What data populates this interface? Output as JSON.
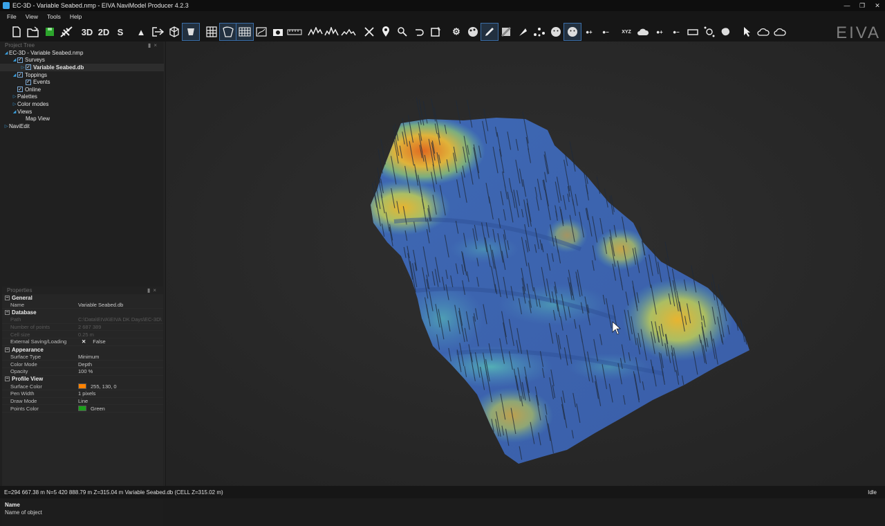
{
  "window": {
    "title": "EC-3D - Variable Seabed.nmp - EIVA NaviModel Producer 4.2.3",
    "controls": [
      "—",
      "❐",
      "✕"
    ]
  },
  "menu": [
    "File",
    "View",
    "Tools",
    "Help"
  ],
  "toolbar": {
    "mode_3d": "3D",
    "mode_2d": "2D",
    "mode_s": "S",
    "icons": [
      "new-project-icon",
      "open-icon",
      "save-icon",
      "satellite-icon",
      "3d-view-icon",
      "2d-view-icon",
      "s-view-icon",
      "north-arrow-icon",
      "import-icon",
      "cube-icon",
      "shade-icon",
      "grid-icon",
      "select-area-icon",
      "mesh-icon",
      "contour-icon",
      "camera-icon",
      "measure-icon",
      "profile-icon",
      "profile2-icon",
      "profile3-icon",
      "tools-icon",
      "pin-icon",
      "route-icon",
      "undo-icon",
      "crop-icon",
      "gear-icon",
      "palette-icon",
      "edit-icon",
      "texture-icon",
      "flag-icon",
      "points-icon",
      "face-icon",
      "face2-icon",
      "point-add-icon",
      "point-remove-icon",
      "xyz-icon",
      "cloud-icon",
      "point-a-icon",
      "point-b-icon",
      "car-icon",
      "nodes-icon",
      "blob-icon",
      "cursor-icon",
      "upload-icon",
      "cloud-out-icon"
    ],
    "logo": "EIVA"
  },
  "project_tree": {
    "header": "Project Tree",
    "items": [
      {
        "label": "EC-3D - Variable Seabed.nmp",
        "level": 0,
        "expander": "open",
        "checkbox": false,
        "bold": false
      },
      {
        "label": "Surveys",
        "level": 1,
        "expander": "open",
        "checkbox": true,
        "bold": false
      },
      {
        "label": "Variable Seabed.db",
        "level": 2,
        "expander": "closed",
        "checkbox": true,
        "bold": true,
        "selected": true
      },
      {
        "label": "Toppings",
        "level": 1,
        "expander": "open",
        "checkbox": true,
        "bold": false
      },
      {
        "label": "Events",
        "level": 2,
        "expander": "none",
        "checkbox": true,
        "bold": false
      },
      {
        "label": "Online",
        "level": 1,
        "expander": "none",
        "checkbox": true,
        "bold": false
      },
      {
        "label": "Palettes",
        "level": 1,
        "expander": "closed",
        "checkbox": false,
        "bold": false
      },
      {
        "label": "Color modes",
        "level": 1,
        "expander": "closed",
        "checkbox": false,
        "bold": false
      },
      {
        "label": "Views",
        "level": 1,
        "expander": "open",
        "checkbox": false,
        "bold": false
      },
      {
        "label": "Map View",
        "level": 2,
        "expander": "none",
        "checkbox": false,
        "bold": false
      },
      {
        "label": "NaviEdit",
        "level": 0,
        "expander": "closed",
        "checkbox": false,
        "bold": false
      }
    ]
  },
  "properties": {
    "header": "Properties",
    "sections": [
      {
        "name": "General",
        "rows": [
          {
            "key": "Name",
            "value": "Variable Seabed.db"
          }
        ]
      },
      {
        "name": "Database",
        "rows": [
          {
            "key": "Path",
            "value": "C:\\Data\\EIVA\\EIVA DK Days\\EC-3D\\",
            "dim": true
          },
          {
            "key": "Number of points",
            "value": "2 687 389",
            "dim": true
          },
          {
            "key": "Cell size",
            "value": "0.25 m",
            "dim": true
          },
          {
            "key": "External Saving/Loading",
            "value": "False",
            "xmark": true
          }
        ]
      },
      {
        "name": "Appearance",
        "rows": [
          {
            "key": "Surface Type",
            "value": "Minimum"
          },
          {
            "key": "Color Mode",
            "value": "Depth"
          },
          {
            "key": "Opacity",
            "value": "100 %"
          }
        ]
      },
      {
        "name": "Profile View",
        "rows": [
          {
            "key": "Surface Color",
            "value": "255, 130, 0",
            "swatch": "#ff8200"
          },
          {
            "key": "Pen Width",
            "value": "1 pixels"
          },
          {
            "key": "Draw Mode",
            "value": "Line"
          },
          {
            "key": "Points Color",
            "value": "Green",
            "swatch": "#1aa01a"
          }
        ]
      }
    ],
    "description": {
      "name": "Name",
      "text": "Name of object"
    }
  },
  "status": {
    "left": "E=294 667.38 m N=5 420 888.79 m Z=315.04 m Variable Seabed.db (CELL Z=315.02 m)",
    "right": "Idle"
  }
}
